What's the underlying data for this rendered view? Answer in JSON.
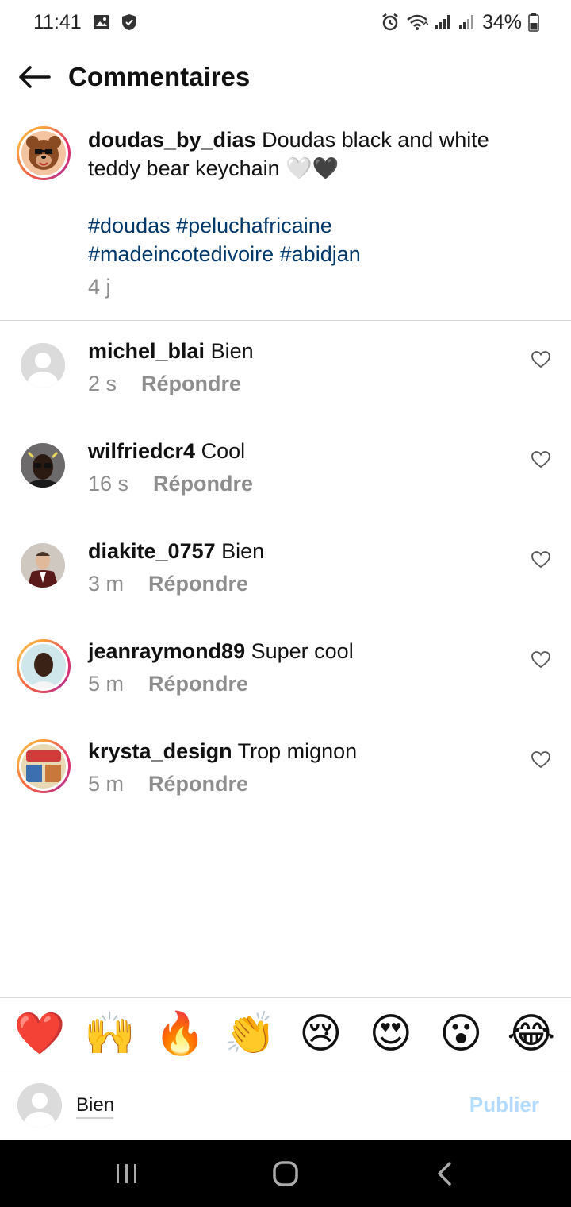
{
  "status_bar": {
    "time": "11:41",
    "battery": "34%",
    "icons": [
      "image-icon",
      "shield-icon",
      "alarm-icon",
      "wifi-icon",
      "signal-icon",
      "signal-icon",
      "battery-icon"
    ]
  },
  "header": {
    "title": "Commentaires",
    "back_icon": "arrow-left-icon"
  },
  "caption": {
    "username": "doudas_by_dias",
    "text": "Doudas black and white teddy bear keychain 🤍🖤",
    "hashtags_line1": "#doudas #peluchafricaine",
    "hashtags_line2": "#madeincotedivoire #abidjan",
    "time": "4 j"
  },
  "comments": [
    {
      "username": "michel_blai",
      "text": "Bien",
      "time": "2 s",
      "reply": "Répondre"
    },
    {
      "username": "wilfriedcr4",
      "text": "Cool",
      "time": "16 s",
      "reply": "Répondre"
    },
    {
      "username": "diakite_0757",
      "text": "Bien",
      "time": "3 m",
      "reply": "Répondre"
    },
    {
      "username": "jeanraymond89",
      "text": "Super cool",
      "time": "5 m",
      "reply": "Répondre"
    },
    {
      "username": "krysta_design",
      "text": "Trop mignon",
      "time": "5 m",
      "reply": "Répondre"
    }
  ],
  "emoji_bar": [
    "❤️",
    "🙌",
    "🔥",
    "👏",
    "😢",
    "😍",
    "😮",
    "😂"
  ],
  "composer": {
    "value": "Bien",
    "publish_label": "Publier"
  },
  "nav_bar": {
    "icons": [
      "recent-apps-icon",
      "home-icon",
      "back-icon"
    ]
  },
  "colors": {
    "hashtag": "#00376b",
    "meta_gray": "#8e8e8e",
    "publish_disabled": "#b3dbff"
  }
}
